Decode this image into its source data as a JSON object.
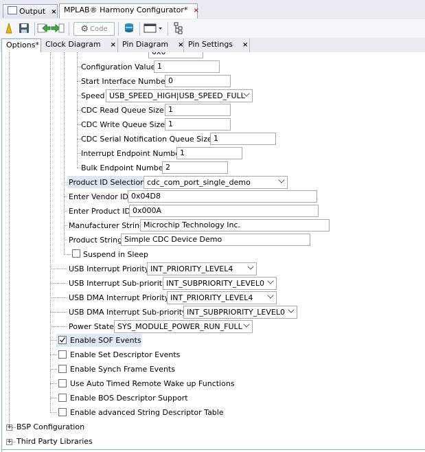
{
  "tabs_top": [
    {
      "label": "Output",
      "close": "×"
    },
    {
      "label": "MPLAB® Harmony Configurator*",
      "close": "×"
    }
  ],
  "toolbar": {
    "code_label": "Code"
  },
  "tabs_second": [
    {
      "label": "Options*",
      "close": ""
    },
    {
      "label": "Clock Diagram",
      "close": "×"
    },
    {
      "label": "Pin Diagram",
      "close": "×"
    },
    {
      "label": "Pin Settings",
      "close": "×"
    }
  ],
  "tree": {
    "cut_row_value": "0x0",
    "configuration_value": {
      "label": "Configuration Value",
      "value": "1"
    },
    "start_interface_number": {
      "label": "Start Interface Number",
      "value": "0"
    },
    "speed": {
      "label": "Speed",
      "value": "USB_SPEED_HIGH|USB_SPEED_FULL"
    },
    "cdc_read_queue": {
      "label": "CDC Read Queue Size",
      "value": "1"
    },
    "cdc_write_queue": {
      "label": "CDC Write Queue Size",
      "value": "1"
    },
    "cdc_serial_notif": {
      "label": "CDC Serial Notification Queue Size",
      "value": "1"
    },
    "interrupt_endpoint": {
      "label": "Interrupt Endpoint Number",
      "value": "1"
    },
    "bulk_endpoint": {
      "label": "Bulk Endpoint Number",
      "value": "2"
    },
    "product_id_selection": {
      "label": "Product ID Selection",
      "value": "cdc_com_port_single_demo"
    },
    "vendor_id": {
      "label": "Enter Vendor ID",
      "value": "0x04D8"
    },
    "product_id": {
      "label": "Enter Product ID",
      "value": "0x000A"
    },
    "manufacturer_string": {
      "label": "Manufacturer String",
      "value": "Microchip Technology Inc."
    },
    "product_string": {
      "label": "Product String",
      "value": "Simple CDC Device Demo"
    },
    "suspend_in_sleep": {
      "label": "Suspend in Sleep",
      "checked": false
    },
    "usb_int_priority": {
      "label": "USB Interrupt Priority",
      "value": "INT_PRIORITY_LEVEL4"
    },
    "usb_int_subpriority": {
      "label": "USB Interrupt Sub-priority",
      "value": "INT_SUBPRIORITY_LEVEL0"
    },
    "usb_dma_int_priority": {
      "label": "USB DMA Interrupt Priority",
      "value": "INT_PRIORITY_LEVEL4"
    },
    "usb_dma_int_subpriority": {
      "label": "USB DMA Interrupt Sub-priority",
      "value": "INT_SUBPRIORITY_LEVEL0"
    },
    "power_state": {
      "label": "Power State",
      "value": "SYS_MODULE_POWER_RUN_FULL"
    },
    "enable_sof": {
      "label": "Enable SOF Events",
      "checked": true
    },
    "enable_set_desc": {
      "label": "Enable Set Descriptor Events",
      "checked": false
    },
    "enable_synch_frame": {
      "label": "Enable Synch Frame Events",
      "checked": false
    },
    "auto_wakeup": {
      "label": "Use Auto Timed Remote Wake up Functions",
      "checked": false
    },
    "bos_desc": {
      "label": "Enable BOS Descriptor Support",
      "checked": false
    },
    "adv_string_desc": {
      "label": "Enable advanced String Descriptor Table",
      "checked": false
    },
    "bsp_config": {
      "label": "BSP Configuration",
      "expander": "+"
    },
    "third_party": {
      "label": "Third Party Libraries",
      "expander": "+"
    }
  }
}
